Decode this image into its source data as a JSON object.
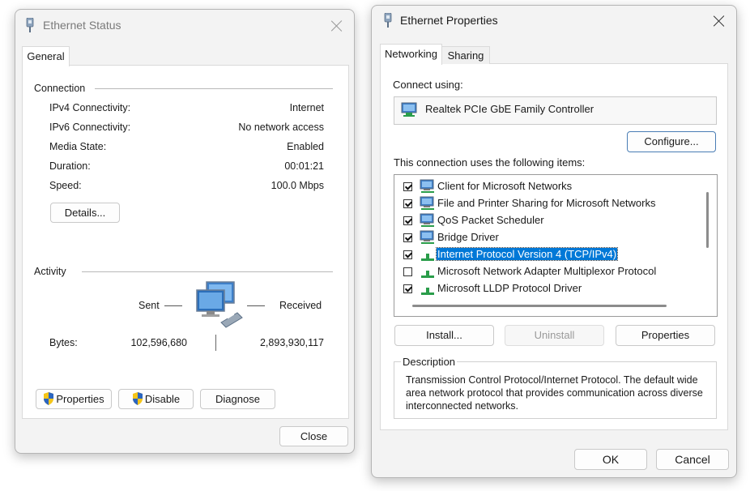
{
  "status_window": {
    "title": "Ethernet Status",
    "tabs": [
      "General"
    ],
    "connection": {
      "heading": "Connection",
      "rows": [
        {
          "label": "IPv4 Connectivity:",
          "value": "Internet"
        },
        {
          "label": "IPv6 Connectivity:",
          "value": "No network access"
        },
        {
          "label": "Media State:",
          "value": "Enabled"
        },
        {
          "label": "Duration:",
          "value": "00:01:21"
        },
        {
          "label": "Speed:",
          "value": "100.0 Mbps"
        }
      ],
      "details_button": "Details..."
    },
    "activity": {
      "heading": "Activity",
      "sent_label": "Sent",
      "received_label": "Received",
      "bytes_label": "Bytes:",
      "bytes_sent": "102,596,680",
      "bytes_received": "2,893,930,117"
    },
    "buttons": {
      "properties": "Properties",
      "disable": "Disable",
      "diagnose": "Diagnose",
      "close": "Close"
    }
  },
  "properties_window": {
    "title": "Ethernet Properties",
    "tabs": [
      "Networking",
      "Sharing"
    ],
    "connect_using_label": "Connect using:",
    "adapter_name": "Realtek PCIe GbE Family Controller",
    "configure_button": "Configure...",
    "items_label": "This connection uses the following items:",
    "items": [
      {
        "label": "Client for Microsoft Networks",
        "checked": true,
        "icon": "network-client-icon"
      },
      {
        "label": "File and Printer Sharing for Microsoft Networks",
        "checked": true,
        "icon": "network-client-icon"
      },
      {
        "label": "QoS Packet Scheduler",
        "checked": true,
        "icon": "network-client-icon"
      },
      {
        "label": "Bridge Driver",
        "checked": true,
        "icon": "network-client-icon"
      },
      {
        "label": "Internet Protocol Version 4 (TCP/IPv4)",
        "checked": true,
        "icon": "protocol-icon",
        "selected": true
      },
      {
        "label": "Microsoft Network Adapter Multiplexor Protocol",
        "checked": false,
        "icon": "protocol-icon"
      },
      {
        "label": "Microsoft LLDP Protocol Driver",
        "checked": true,
        "icon": "protocol-icon"
      }
    ],
    "install_button": "Install...",
    "uninstall_button": "Uninstall",
    "properties_button": "Properties",
    "description_heading": "Description",
    "description_text": "Transmission Control Protocol/Internet Protocol. The default wide area network protocol that provides communication across diverse interconnected networks.",
    "ok_button": "OK",
    "cancel_button": "Cancel"
  },
  "colors": {
    "selection": "#0078d7",
    "accent": "#4a7db5"
  }
}
